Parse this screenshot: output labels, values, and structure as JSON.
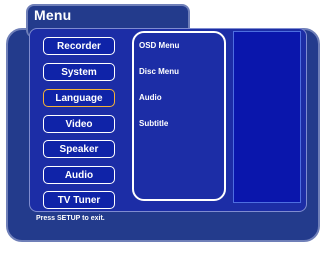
{
  "menu": {
    "title": "Menu",
    "left_items": [
      {
        "label": "Recorder",
        "selected": false
      },
      {
        "label": "System",
        "selected": false
      },
      {
        "label": "Language",
        "selected": true
      },
      {
        "label": "Video",
        "selected": false
      },
      {
        "label": "Speaker",
        "selected": false
      },
      {
        "label": "Audio",
        "selected": false
      },
      {
        "label": "TV Tuner",
        "selected": false
      }
    ],
    "middle_items": [
      "OSD Menu",
      "Disc Menu",
      "Audio",
      "Subtitle"
    ],
    "footer_text": "Press SETUP to exit."
  },
  "colors": {
    "panel_bg": "#233b8c",
    "inner_bg": "#1c2da6",
    "button_bg": "#0f23a8",
    "selected_border": "#f3b237",
    "right_box_bg": "#0a16ac"
  }
}
